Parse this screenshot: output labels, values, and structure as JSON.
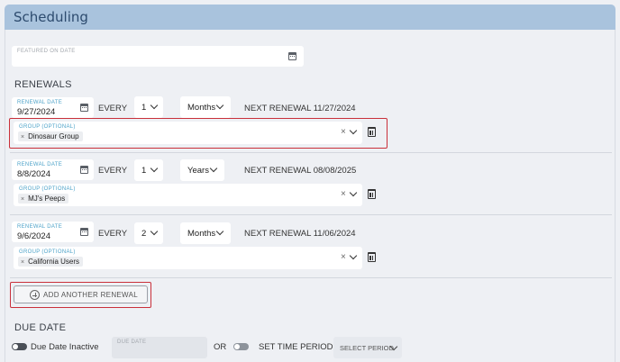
{
  "header": {
    "title": "Scheduling"
  },
  "featured": {
    "label": "FEATURED ON DATE",
    "value": "",
    "icon": "calendar-icon"
  },
  "renewals": {
    "heading": "RENEWALS",
    "every_label": "EVERY",
    "items": [
      {
        "date_label": "RENEWAL DATE",
        "date": "9/27/2024",
        "count": "1",
        "unit": "Months",
        "next": "NEXT RENEWAL 11/27/2024",
        "group_label": "GROUP (OPTIONAL)",
        "group": "Dinosaur Group"
      },
      {
        "date_label": "RENEWAL DATE",
        "date": "8/8/2024",
        "count": "1",
        "unit": "Years",
        "next": "NEXT RENEWAL 08/08/2025",
        "group_label": "GROUP (OPTIONAL)",
        "group": "MJ's Peeps"
      },
      {
        "date_label": "RENEWAL DATE",
        "date": "9/6/2024",
        "count": "2",
        "unit": "Months",
        "next": "NEXT RENEWAL 11/06/2024",
        "group_label": "GROUP (OPTIONAL)",
        "group": "California Users"
      }
    ],
    "add_label": "ADD ANOTHER RENEWAL"
  },
  "due": {
    "heading": "DUE DATE",
    "inactive_label": "Due Date Inactive",
    "date_label": "DUE DATE",
    "or_label": "OR",
    "set_period_label": "SET TIME PERIOD",
    "select_period": "SELECT PERIOD"
  },
  "colors": {
    "header_bg": "#a9c3dd",
    "highlight": "#c9303a",
    "label_blue": "#4ea3c9"
  }
}
